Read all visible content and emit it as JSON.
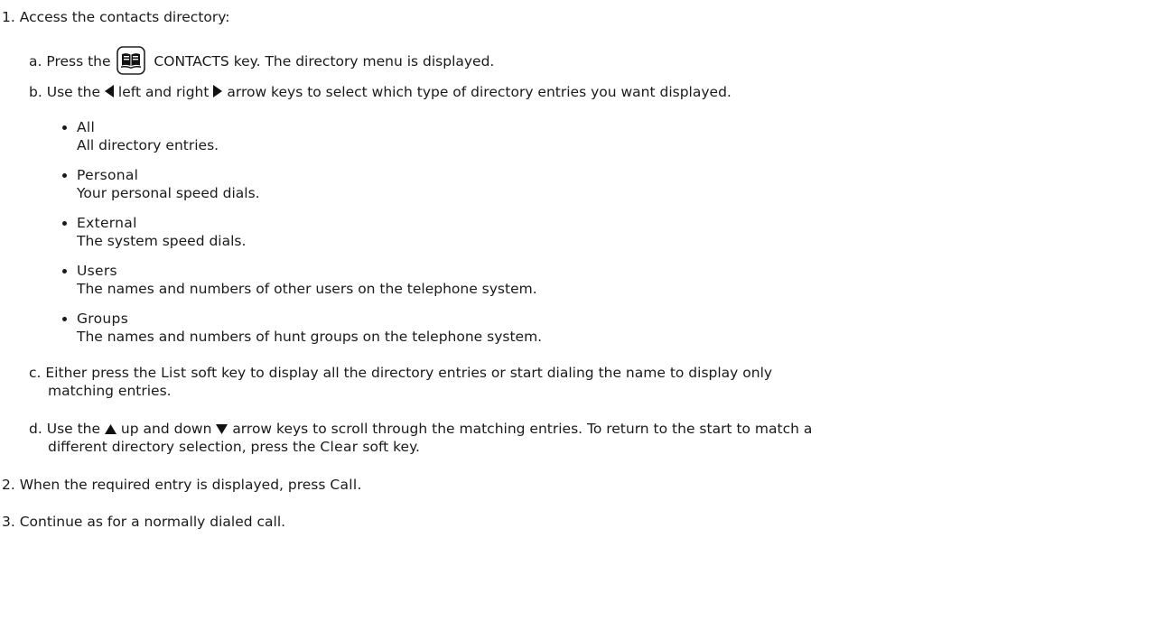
{
  "steps": [
    {
      "num": "1.",
      "text": "Access the contacts directory:",
      "substeps": [
        {
          "letter": "a.",
          "pre": "Press the",
          "post": "CONTACTS key. The directory menu is displayed.",
          "icon": "book-icon"
        },
        {
          "letter": "b.",
          "pre": "Use the",
          "mid": "left and right",
          "post": "arrow keys to select which type of directory entries you want displayed.",
          "icons": [
            "left-arrow-icon",
            "right-arrow-icon"
          ]
        },
        {
          "letter": "c.",
          "pre": "Either press the",
          "key": "List",
          "post": "soft key to display all the directory entries or start dialing the name to display only",
          "cont": "matching entries."
        },
        {
          "letter": "d.",
          "pre": "Use the",
          "mid": "up and down",
          "post": "arrow keys to scroll through the matching entries. To return to the start to match a",
          "cont_pre": "different directory selection, press the",
          "key": "Clear",
          "cont_post": "soft key.",
          "icons": [
            "up-arrow-icon",
            "down-arrow-icon"
          ]
        }
      ]
    },
    {
      "num": "2.",
      "pre": "When the required entry is displayed, press",
      "key": "Call",
      "post": "."
    },
    {
      "num": "3.",
      "text": "Continue as for a normally dialed call."
    }
  ],
  "directory_types": [
    {
      "name": "All",
      "desc": "All directory entries."
    },
    {
      "name": "Personal",
      "desc": "Your personal speed dials."
    },
    {
      "name": "External",
      "desc": "The system speed dials."
    },
    {
      "name": "Users",
      "desc": "The names and numbers of other users on the telephone system."
    },
    {
      "name": "Groups",
      "desc": "The names and numbers of hunt groups on the telephone system."
    }
  ]
}
